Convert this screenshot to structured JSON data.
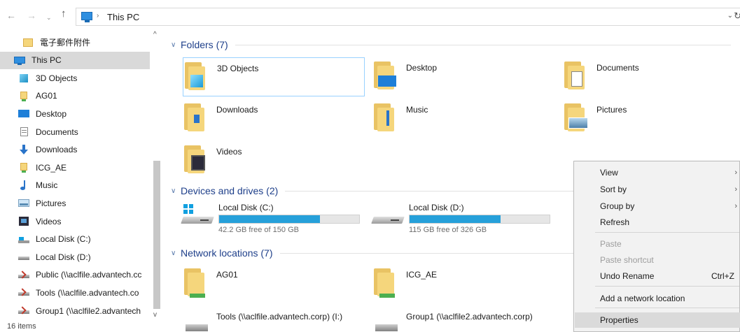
{
  "address_bar": {
    "path_root_separator": "›",
    "path": "This PC",
    "dropdown_glyph": "⌄",
    "refresh_glyph": "↻"
  },
  "nav_glyphs": {
    "back": "←",
    "forward": "→",
    "recent": "⌄",
    "up": "↑"
  },
  "navigation_pane": {
    "items": [
      {
        "label": "電子郵件附件",
        "icon": "folder-icon"
      },
      {
        "label": "This PC",
        "icon": "computer-icon",
        "selected": true
      },
      {
        "label": "3D Objects",
        "icon": "cube-icon"
      },
      {
        "label": "AG01",
        "icon": "network-folder-icon"
      },
      {
        "label": "Desktop",
        "icon": "desktop-icon"
      },
      {
        "label": "Documents",
        "icon": "document-icon"
      },
      {
        "label": "Downloads",
        "icon": "download-icon"
      },
      {
        "label": "ICG_AE",
        "icon": "network-folder-icon"
      },
      {
        "label": "Music",
        "icon": "music-icon"
      },
      {
        "label": "Pictures",
        "icon": "picture-icon"
      },
      {
        "label": "Videos",
        "icon": "video-icon"
      },
      {
        "label": "Local Disk (C:)",
        "icon": "system-drive-icon"
      },
      {
        "label": "Local Disk (D:)",
        "icon": "drive-icon"
      },
      {
        "label": "Public (\\\\aclfile.advantech.cc",
        "icon": "network-drive-icon"
      },
      {
        "label": "Tools (\\\\aclfile.advantech.co",
        "icon": "network-drive-icon"
      },
      {
        "label": "Group1 (\\\\aclfile2.advantech",
        "icon": "network-drive-icon"
      }
    ],
    "scroll_up_glyph": "^",
    "scroll_down_glyph": "v"
  },
  "status_bar": {
    "item_count": "16 items"
  },
  "groups": {
    "folders": {
      "title": "Folders (7)",
      "chevron": "∨",
      "items": [
        {
          "label": "3D Objects",
          "icon": "3d-objects-folder-icon"
        },
        {
          "label": "Desktop",
          "icon": "desktop-folder-icon"
        },
        {
          "label": "Documents",
          "icon": "documents-folder-icon"
        },
        {
          "label": "Downloads",
          "icon": "downloads-folder-icon"
        },
        {
          "label": "Music",
          "icon": "music-folder-icon"
        },
        {
          "label": "Pictures",
          "icon": "pictures-folder-icon"
        },
        {
          "label": "Videos",
          "icon": "videos-folder-icon"
        }
      ]
    },
    "devices": {
      "title": "Devices and drives (2)",
      "chevron": "∨",
      "items": [
        {
          "label": "Local Disk (C:)",
          "free_text": "42.2 GB free of 150 GB",
          "used_fraction": 0.72,
          "system": true
        },
        {
          "label": "Local Disk (D:)",
          "free_text": "115 GB free of 326 GB",
          "used_fraction": 0.65,
          "system": false
        }
      ]
    },
    "network": {
      "title": "Network locations (7)",
      "chevron": "∨",
      "items": [
        {
          "label": "AG01",
          "icon": "network-folder-icon"
        },
        {
          "label": "ICG_AE",
          "icon": "network-folder-icon"
        },
        {
          "label": "Tools (\\\\aclfile.advantech.corp) (I:)",
          "icon": "network-drive-icon"
        },
        {
          "label": "Group1 (\\\\aclfile2.advantech.corp)",
          "icon": "network-drive-icon"
        }
      ]
    }
  },
  "context_menu": {
    "items": [
      {
        "label": "View",
        "submenu": true,
        "arrow": "›"
      },
      {
        "label": "Sort by",
        "submenu": true,
        "arrow": "›"
      },
      {
        "label": "Group by",
        "submenu": true,
        "arrow": "›"
      },
      {
        "label": "Refresh"
      },
      {
        "label": "Paste",
        "disabled": true
      },
      {
        "label": "Paste shortcut",
        "disabled": true
      },
      {
        "label": "Undo Rename",
        "shortcut": "Ctrl+Z"
      },
      {
        "label": "Add a network location"
      },
      {
        "label": "Properties",
        "hover": true
      }
    ]
  },
  "colors": {
    "accent": "#26a0da",
    "group_header": "#1e3f8a",
    "folder": "#f5d67c",
    "selection": "#d9d9d9",
    "menu_bg": "#f2f2f2"
  }
}
